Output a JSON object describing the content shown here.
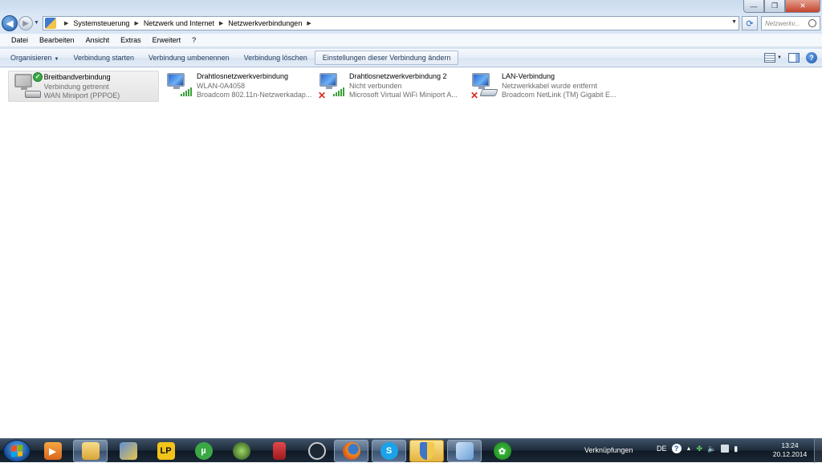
{
  "window": {
    "controls": {
      "minimize": "—",
      "maximize": "❐",
      "close": "✕"
    }
  },
  "navigation": {
    "back_icon": "arrow-left-icon",
    "forward_icon": "arrow-right-icon",
    "breadcrumb": [
      "Systemsteuerung",
      "Netzwerk und Internet",
      "Netzwerkverbindungen"
    ],
    "refresh_icon": "refresh-icon",
    "search_placeholder": "Netzwerkv..."
  },
  "menubar": {
    "items": [
      "Datei",
      "Bearbeiten",
      "Ansicht",
      "Extras",
      "Erweitert",
      "?"
    ]
  },
  "commandbar": {
    "organize": "Organisieren",
    "start": "Verbindung starten",
    "rename": "Verbindung umbenennen",
    "delete": "Verbindung löschen",
    "settings": "Einstellungen dieser Verbindung ändern"
  },
  "connections": [
    {
      "name": "Breitbandverbindung",
      "status": "Verbindung getrennt",
      "device": "WAN Miniport (PPPOE)",
      "state": "connected-check",
      "selected": true
    },
    {
      "name": "Drahtlosnetzwerkverbindung",
      "status": "WLAN-0A4058",
      "device": "Broadcom 802.11n-Netzwerkadap...",
      "state": "wifi-signal",
      "selected": false
    },
    {
      "name": "Drahtlosnetzwerkverbindung 2",
      "status": "Nicht verbunden",
      "device": "Microsoft Virtual WiFi Miniport A...",
      "state": "disconnected-wifi",
      "selected": false
    },
    {
      "name": "LAN-Verbindung",
      "status": "Netzwerkkabel wurde entfernt",
      "device": "Broadcom NetLink (TM) Gigabit E...",
      "state": "disconnected-cable",
      "selected": false
    }
  ],
  "taskbar": {
    "apps": [
      "media-player-icon",
      "file-explorer-icon",
      "pinned-app-icon",
      "lp-app-icon",
      "utorrent-icon",
      "app-icon",
      "book-app-icon",
      "q-app-icon",
      "firefox-icon",
      "skype-icon",
      "security-shield-icon",
      "network-connections-icon",
      "icq-icon"
    ],
    "lp_text": "LP",
    "toolbar_label": "Verknüpfungen",
    "language": "DE",
    "time": "13:24",
    "date": "20.12.2014"
  },
  "colors": {
    "accent": "#1d5aa8",
    "cmdbar_text": "#1e395b",
    "status_gray": "#6d6d6d",
    "error_red": "#d8291f",
    "ok_green": "#3aa845"
  }
}
